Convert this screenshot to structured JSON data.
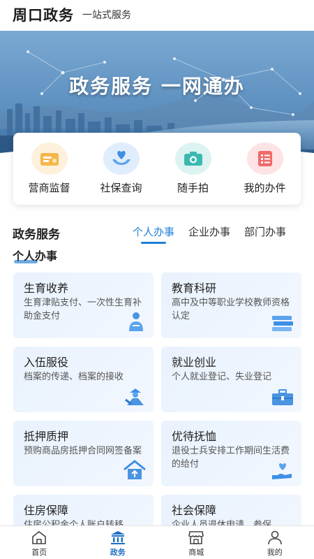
{
  "header": {
    "title": "周口政务",
    "subtitle": "一站式服务"
  },
  "banner": {
    "slogan": "政务服务 一网通办"
  },
  "quick_actions": [
    {
      "label": "营商监督",
      "icon": "briefcase-icon",
      "color": "#f5b64a"
    },
    {
      "label": "社保查询",
      "icon": "heart-hands-icon",
      "color": "#3d8fe5"
    },
    {
      "label": "随手拍",
      "icon": "camera-icon",
      "color": "#3cb8b0"
    },
    {
      "label": "我的办件",
      "icon": "list-icon",
      "color": "#f06a6a"
    }
  ],
  "section": {
    "title": "政务服务",
    "tabs": [
      "个人办事",
      "企业办事",
      "部门办事"
    ],
    "active_tab": "个人办事",
    "subtitle": "个人办事"
  },
  "cards": [
    {
      "title": "生育收养",
      "desc": "生育津贴支付、一次性生育补助金支付",
      "icon": "person-icon"
    },
    {
      "title": "教育科研",
      "desc": "高中及中等职业学校教师资格认定",
      "icon": "books-icon"
    },
    {
      "title": "入伍服役",
      "desc": "档案的传递、档案的接收",
      "icon": "soldier-icon"
    },
    {
      "title": "就业创业",
      "desc": "个人就业登记、失业登记",
      "icon": "toolbox-icon"
    },
    {
      "title": "抵押质押",
      "desc": "预购商品房抵押合同网签备案",
      "icon": "house-icon"
    },
    {
      "title": "优待抚恤",
      "desc": "退役士兵安排工作期间生活费的给付",
      "icon": "hand-heart-icon"
    },
    {
      "title": "住房保障",
      "desc": "住房公积金个人账户转移",
      "icon": "home-icon"
    },
    {
      "title": "社会保障",
      "desc": "企业人员退休申请、参保",
      "icon": "shield-icon"
    }
  ],
  "bottom_nav": [
    {
      "label": "首页",
      "icon": "home-icon"
    },
    {
      "label": "政务",
      "icon": "government-icon",
      "active": true
    },
    {
      "label": "商城",
      "icon": "store-icon"
    },
    {
      "label": "我的",
      "icon": "user-icon"
    }
  ],
  "colors": {
    "accent": "#1f7fd9",
    "card_bg": "#eaf3fd"
  }
}
